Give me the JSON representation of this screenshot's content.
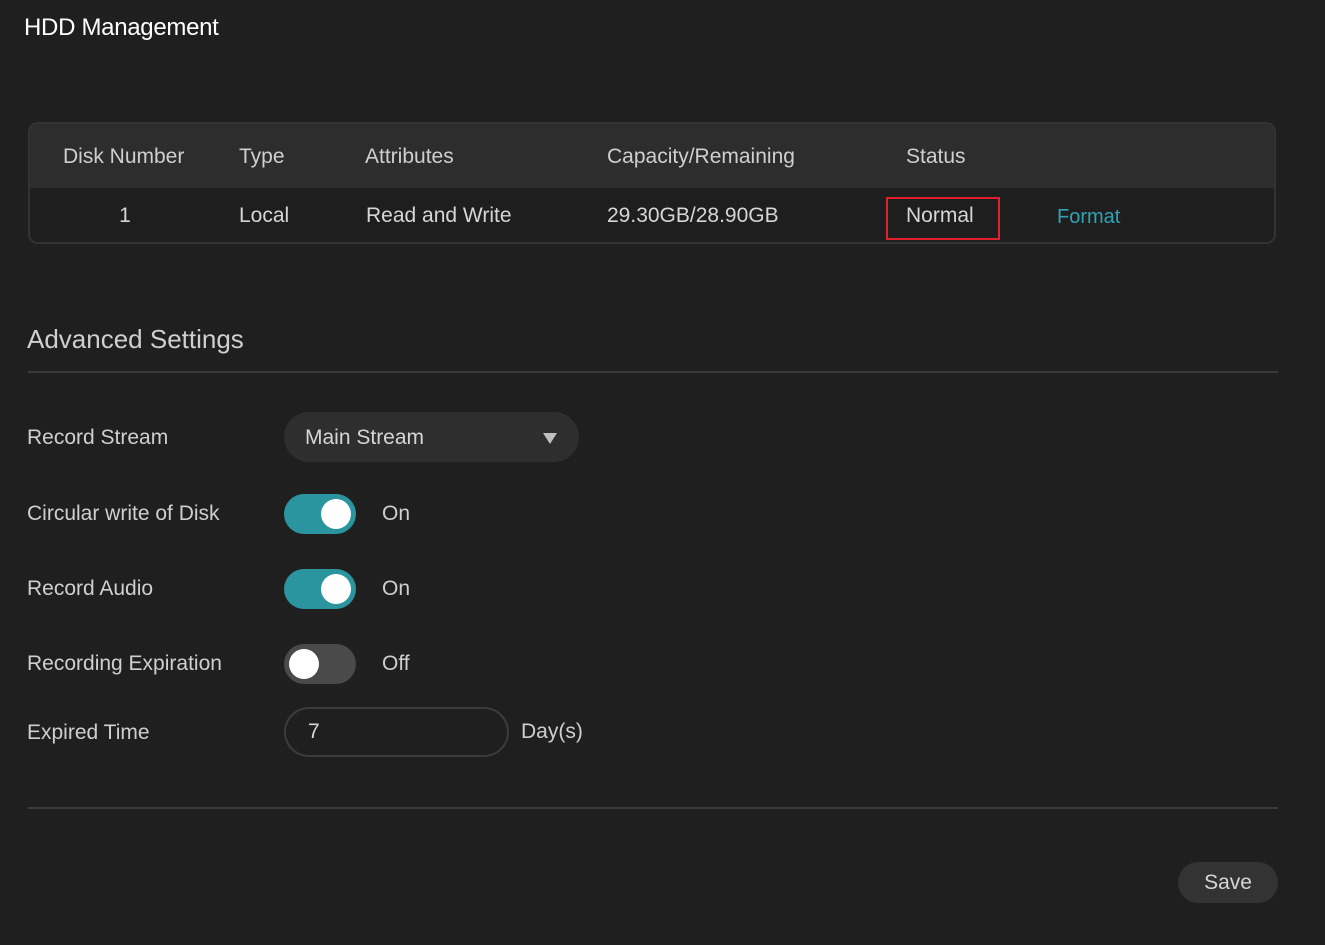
{
  "page": {
    "title": "HDD Management"
  },
  "disk_table": {
    "headers": [
      "Disk Number",
      "Type",
      "Attributes",
      "Capacity/Remaining",
      "Status"
    ],
    "rows": [
      {
        "disk_number": "1",
        "type": "Local",
        "attributes": "Read and Write",
        "capacity_remaining": "29.30GB/28.90GB",
        "status": "Normal",
        "action": "Format"
      }
    ]
  },
  "advanced": {
    "title": "Advanced Settings",
    "record_stream": {
      "label": "Record Stream",
      "value": "Main Stream"
    },
    "circular_write": {
      "label": "Circular write of Disk",
      "state": "On"
    },
    "record_audio": {
      "label": "Record Audio",
      "state": "On"
    },
    "recording_expiration": {
      "label": "Recording Expiration",
      "state": "Off"
    },
    "expired_time": {
      "label": "Expired Time",
      "value": "7",
      "unit": "Day(s)"
    }
  },
  "footer": {
    "save_label": "Save"
  },
  "colors": {
    "background": "#1f1f1f",
    "accent": "#2a949f",
    "link": "#2fa3b3",
    "highlight_box": "#e0202c"
  }
}
